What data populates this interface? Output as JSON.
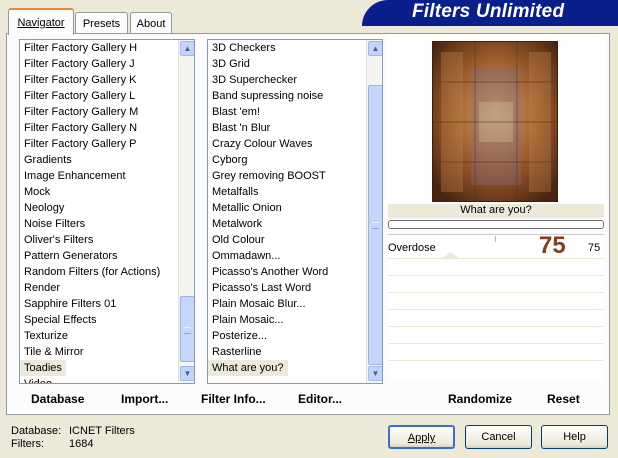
{
  "tabs": [
    {
      "label": "Navigator",
      "active": true
    },
    {
      "label": "Presets",
      "active": false
    },
    {
      "label": "About",
      "active": false
    }
  ],
  "banner": {
    "title": "Filters Unlimited"
  },
  "categories": {
    "items": [
      "Filter Factory Gallery H",
      "Filter Factory Gallery J",
      "Filter Factory Gallery K",
      "Filter Factory Gallery L",
      "Filter Factory Gallery M",
      "Filter Factory Gallery N",
      "Filter Factory Gallery P",
      "Gradients",
      "Image Enhancement",
      "Mock",
      "Neology",
      "Noise Filters",
      "Oliver's Filters",
      "Pattern Generators",
      "Random Filters (for Actions)",
      "Render",
      "Sapphire Filters 01",
      "Special Effects",
      "Texturize",
      "Tile & Mirror",
      "Toadies",
      "Video"
    ],
    "selected": "Toadies"
  },
  "filters": {
    "items": [
      "3D Checkers",
      "3D Grid",
      "3D Superchecker",
      "Band supressing noise",
      "Blast 'em!",
      "Blast 'n Blur",
      "Crazy Colour Waves",
      "Cyborg",
      "Grey removing BOOST",
      "Metalfalls",
      "Metallic Onion",
      "Metalwork",
      "Old Colour",
      "Ommadawn...",
      "Picasso's Another Word",
      "Picasso's Last Word",
      "Plain Mosaic Blur...",
      "Plain Mosaic...",
      "Posterize...",
      "Rasterline",
      "What are you?"
    ],
    "selected": "What are you?"
  },
  "toolbar": {
    "database": "Database",
    "import": "Import...",
    "filter_info": "Filter Info...",
    "editor": "Editor...",
    "randomize": "Randomize",
    "reset": "Reset"
  },
  "preview": {
    "filter_name": "What are you?",
    "progress": 0
  },
  "parameter": {
    "name": "Overdose",
    "big_value": "75",
    "value": "75",
    "fraction": 0.29
  },
  "status": {
    "database_label": "Database:",
    "database_value": "ICNET Filters",
    "filters_label": "Filters:",
    "filters_value": "1684"
  },
  "buttons": {
    "apply": "Apply",
    "cancel": "Cancel",
    "help": "Help"
  },
  "colors": {
    "banner": "#0b1f8c",
    "big_value": "#8a3c1c",
    "selection": "#ece9d8"
  }
}
